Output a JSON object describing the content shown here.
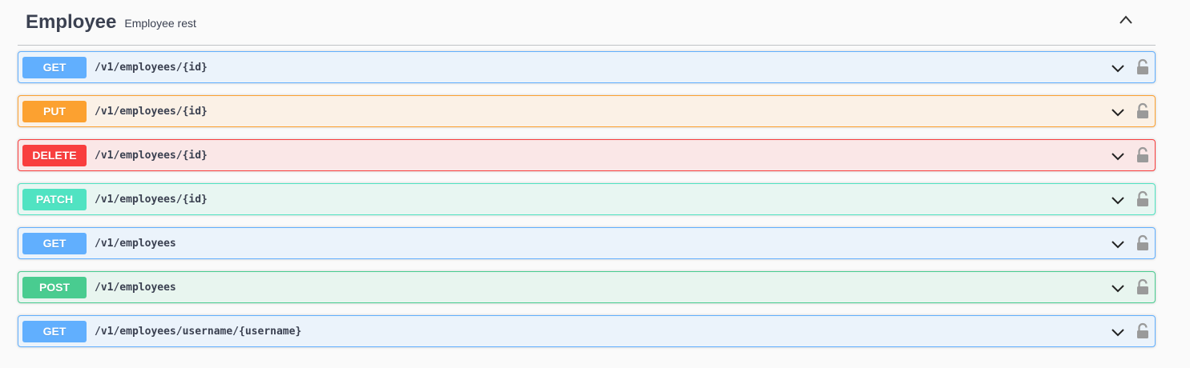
{
  "tag": {
    "title": "Employee",
    "description": "Employee rest"
  },
  "operations": [
    {
      "method": "GET",
      "path": "/v1/employees/{id}"
    },
    {
      "method": "PUT",
      "path": "/v1/employees/{id}"
    },
    {
      "method": "DELETE",
      "path": "/v1/employees/{id}"
    },
    {
      "method": "PATCH",
      "path": "/v1/employees/{id}"
    },
    {
      "method": "GET",
      "path": "/v1/employees"
    },
    {
      "method": "POST",
      "path": "/v1/employees"
    },
    {
      "method": "GET",
      "path": "/v1/employees/username/{username}"
    }
  ],
  "colors": {
    "GET": {
      "badge": "#61affe",
      "bg": "#ebf3fb",
      "border": "#61affe"
    },
    "PUT": {
      "badge": "#fca130",
      "bg": "#fbf1e6",
      "border": "#fca130"
    },
    "DELETE": {
      "badge": "#f93e3e",
      "bg": "#fae7e7",
      "border": "#f93e3e"
    },
    "PATCH": {
      "badge": "#50e3c2",
      "bg": "#e8f6f2",
      "border": "#50e3c2"
    },
    "POST": {
      "badge": "#49cc90",
      "bg": "#e8f5ef",
      "border": "#49cc90"
    }
  },
  "icons": {
    "collapse": "chevron-up-icon",
    "expand": "chevron-down-icon",
    "lock": "lock-icon"
  }
}
